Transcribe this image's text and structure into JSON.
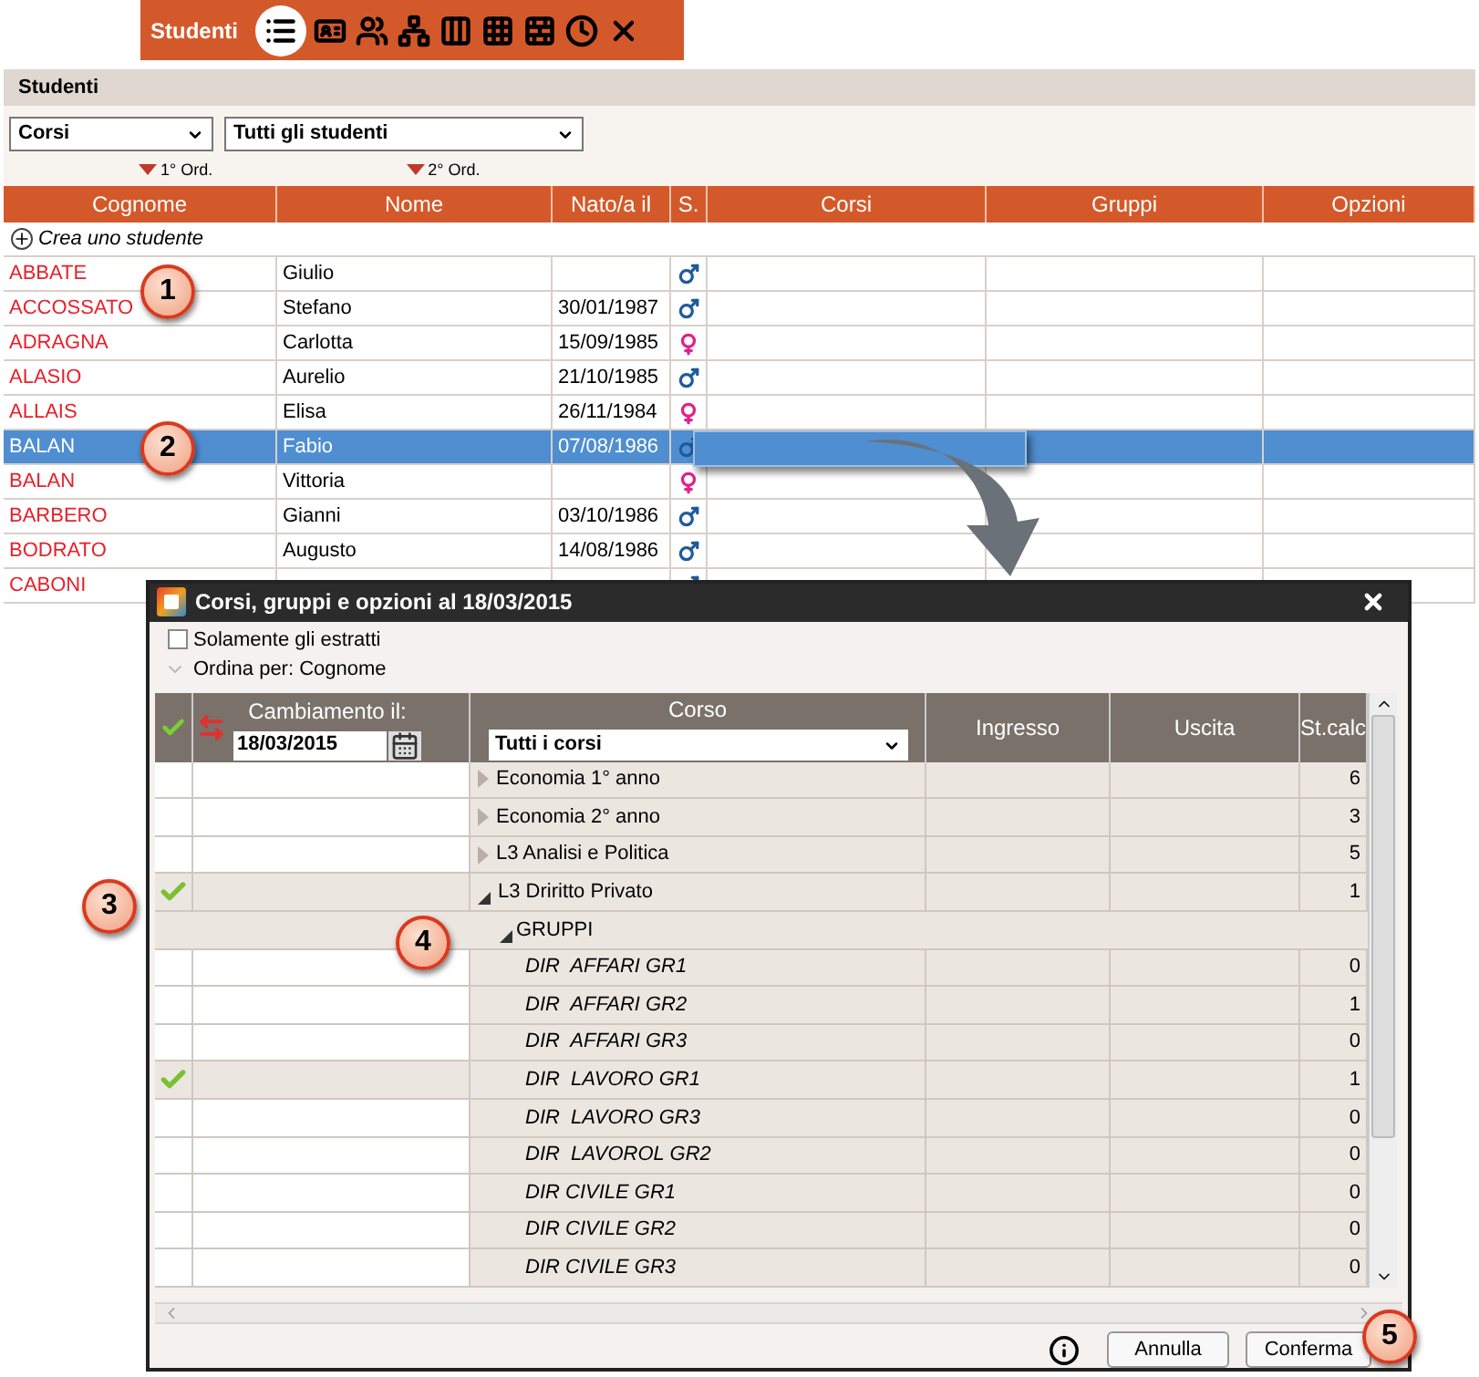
{
  "toolbar": {
    "title": "Studenti",
    "buttons": [
      {
        "kind": "list",
        "selected": true
      },
      {
        "kind": "card",
        "selected": false
      },
      {
        "kind": "people",
        "selected": false
      },
      {
        "kind": "tree",
        "selected": false
      },
      {
        "kind": "columns",
        "selected": false
      },
      {
        "kind": "grid",
        "selected": false
      },
      {
        "kind": "bricks",
        "selected": false
      },
      {
        "kind": "clock",
        "selected": false
      },
      {
        "kind": "remove",
        "selected": false
      }
    ]
  },
  "panel": {
    "title": "Studenti",
    "filters": [
      {
        "value": "Corsi"
      },
      {
        "value": "Tutti gli studenti"
      }
    ],
    "sort_marks": [
      {
        "label": "1° Ord."
      },
      {
        "label": "2° Ord."
      }
    ],
    "columns": [
      "Cognome",
      "Nome",
      "Nato/a il",
      "S.",
      "Corsi",
      "Gruppi",
      "Opzioni"
    ],
    "create_label": "Crea uno studente",
    "rows": [
      {
        "surname": "ABBATE",
        "name": "Giulio",
        "born": "",
        "kind": "male",
        "selected": false
      },
      {
        "surname": "ACCOSSATO",
        "name": "Stefano",
        "born": "30/01/1987",
        "kind": "male",
        "selected": false
      },
      {
        "surname": "ADRAGNA",
        "name": "Carlotta",
        "born": "15/09/1985",
        "kind": "female",
        "selected": false
      },
      {
        "surname": "ALASIO",
        "name": "Aurelio",
        "born": "21/10/1985",
        "kind": "male",
        "selected": false
      },
      {
        "surname": "ALLAIS",
        "name": "Elisa",
        "born": "26/11/1984",
        "kind": "female",
        "selected": false
      },
      {
        "surname": "BALAN",
        "name": "Fabio",
        "born": "07/08/1986",
        "kind": "male",
        "selected": true
      },
      {
        "surname": "BALAN",
        "name": "Vittoria",
        "born": "",
        "kind": "female",
        "selected": false
      },
      {
        "surname": "BARBERO",
        "name": "Gianni",
        "born": "03/10/1986",
        "kind": "male",
        "selected": false
      },
      {
        "surname": "BODRATO",
        "name": "Augusto",
        "born": "14/08/1986",
        "kind": "male",
        "selected": false
      },
      {
        "surname": "CABONI",
        "name": "",
        "born": "",
        "kind": "male",
        "selected": false
      }
    ]
  },
  "dialog": {
    "title": "Corsi, gruppi e opzioni al 18/03/2015",
    "only_extracted": {
      "label": "Solamente gli estratti",
      "checked": false
    },
    "sort_by": "Ordina per: Cognome",
    "header": {
      "change_label": "Cambiamento il:",
      "change_date": "18/03/2015",
      "course_label": "Corso",
      "course_filter": "Tutti i corsi",
      "columns": [
        "Ingresso",
        "Uscita",
        "St.calc"
      ]
    },
    "rows": [
      {
        "kind": "course",
        "label": "Economia 1° anno",
        "expanded": false,
        "checked": false,
        "count": "6"
      },
      {
        "kind": "course",
        "label": "Economia 2° anno",
        "expanded": false,
        "checked": false,
        "count": "3"
      },
      {
        "kind": "course",
        "label": "L3 Analisi e Politica",
        "expanded": false,
        "checked": false,
        "count": "5"
      },
      {
        "kind": "course",
        "label": "L3 Driritto Privato",
        "expanded": true,
        "checked": true,
        "count": "1"
      },
      {
        "kind": "section",
        "label": "GRUPPI",
        "expanded": true
      },
      {
        "kind": "group",
        "label": "DIR  AFFARI GR1",
        "checked": false,
        "count": "0"
      },
      {
        "kind": "group",
        "label": "DIR  AFFARI GR2",
        "checked": false,
        "count": "1"
      },
      {
        "kind": "group",
        "label": "DIR  AFFARI GR3",
        "checked": false,
        "count": "0"
      },
      {
        "kind": "group",
        "label": "DIR  LAVORO GR1",
        "checked": true,
        "count": "1"
      },
      {
        "kind": "group",
        "label": "DIR  LAVORO GR3",
        "checked": false,
        "count": "0"
      },
      {
        "kind": "group",
        "label": "DIR  LAVOROL GR2",
        "checked": false,
        "count": "0"
      },
      {
        "kind": "group",
        "label": "DIR CIVILE GR1",
        "checked": false,
        "count": "0"
      },
      {
        "kind": "group",
        "label": "DIR CIVILE GR2",
        "checked": false,
        "count": "0"
      },
      {
        "kind": "group",
        "label": "DIR CIVILE GR3",
        "checked": false,
        "count": "0"
      }
    ],
    "buttons": [
      "Annulla",
      "Conferma"
    ]
  },
  "callouts": [
    "1",
    "2",
    "3",
    "4",
    "5"
  ]
}
